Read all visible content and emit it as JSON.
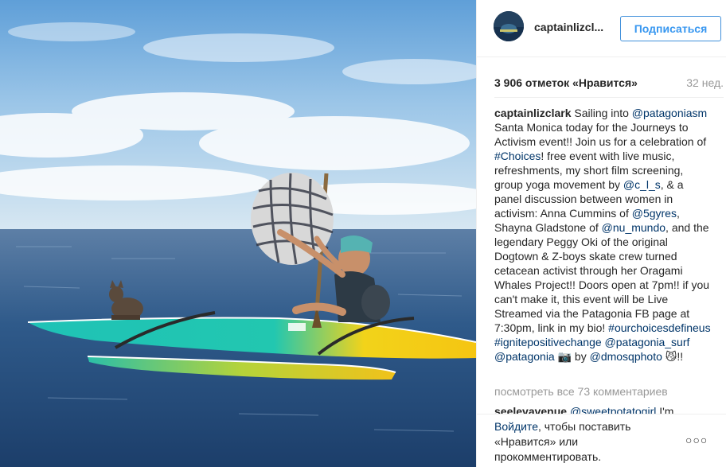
{
  "header": {
    "username": "captainlizcl...",
    "follow_label": "Подписаться"
  },
  "stats": {
    "likes": "3 906 отметок «Нравится»",
    "age": "32 нед."
  },
  "caption": {
    "username": "captainlizclark",
    "t1": " Sailing into ",
    "l1": "@patagoniasm",
    "t2": " Santa Monica today for the Journeys to Activism event!! Join us for a celebration of ",
    "l2": "#Choices",
    "t3": "! free event with live music, refreshments, my short film screening, group yoga movement by ",
    "l3": "@c_l_s",
    "t4": ", & a panel discussion between women in activism: Anna Cummins of ",
    "l4": "@5gyres",
    "t5": ", Shayna Gladstone of ",
    "l5": "@nu_mundo",
    "t6": ", and the legendary Peggy Oki of the original Dogtown & Z-boys skate crew turned cetacean activist through her Oragami Whales Project!! Doors open at 7pm!! if you can't make it, this event will be Live Streamed via the Patagonia FB page at 7:30pm, link in my bio! ",
    "l6": "#ourchoicesdefineus",
    "t7": " ",
    "l7": "#ignitepositivechange",
    "t8": " ",
    "l8": "@patagonia_surf",
    "t9": " ",
    "l9": "@patagonia",
    "t10": " 📷 by ",
    "l10": "@dmosqphoto",
    "t11": " 😼!!"
  },
  "comments": {
    "view_all": "посмотреть все 73 комментариев",
    "first_username": "seelevavenue",
    "first_mention": "@sweetpotatogirl",
    "first_text": " I'm"
  },
  "login_prompt": {
    "login_link": "Войдите",
    "text1": ", чтобы поставить «Нравится» или прокомментировать."
  },
  "more_options": "○○○",
  "colors": {
    "link": "#003569",
    "follow": "#3897f0",
    "muted": "#999999",
    "text": "#262626"
  },
  "icons": {
    "more": "more-options-icon"
  }
}
